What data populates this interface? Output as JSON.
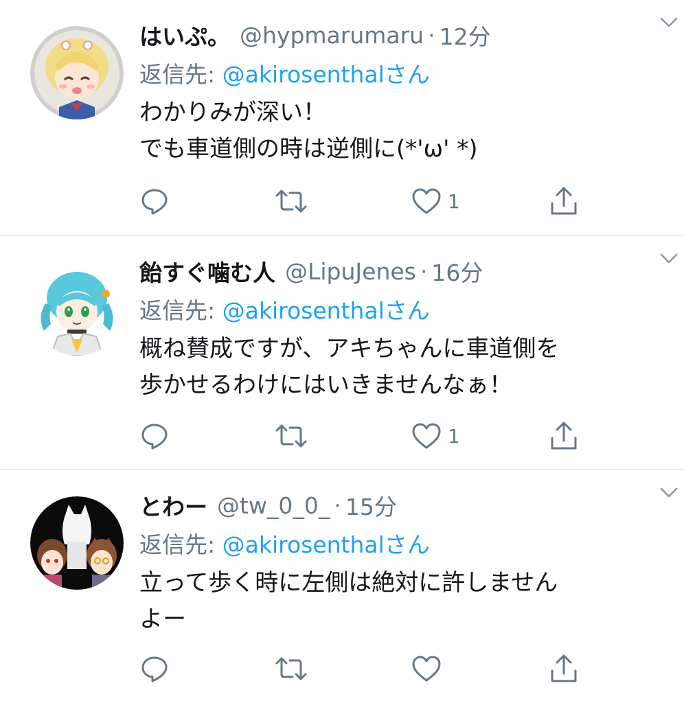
{
  "tweets": [
    {
      "name": "はいぷ。",
      "handle": "@hypmarumaru",
      "separator": "·",
      "time": "12分",
      "reply_prefix": "返信先: ",
      "reply_mention": "@akirosenthalさん",
      "text": "わかりみが深い！\nでも車道側の時は逆側に(*'ω' *)",
      "like_count": "1",
      "avatar_icon": "avatar-blonde-girl"
    },
    {
      "name": "飴すぐ噛む人",
      "handle": "@LipuJenes",
      "separator": "·",
      "time": "16分",
      "reply_prefix": "返信先: ",
      "reply_mention": "@akirosenthalさん",
      "text": "概ね賛成ですが、アキちゃんに車道側を\n歩かせるわけにはいきませんなぁ！",
      "like_count": "1",
      "avatar_icon": "avatar-cyan-hair-girl"
    },
    {
      "name": "とわー",
      "handle": "@tw_0_0_",
      "separator": "·",
      "time": "15分",
      "reply_prefix": "返信先: ",
      "reply_mention": "@akirosenthalさん",
      "text": "立って歩く時に左側は絶対に許しません\nよー",
      "like_count": "",
      "avatar_icon": "avatar-group-dark"
    }
  ],
  "icons": {
    "caret": "chevron-down-icon",
    "reply": "reply-icon",
    "retweet": "retweet-icon",
    "like": "heart-icon",
    "share": "share-icon"
  },
  "colors": {
    "mention": "#1da1f2",
    "secondary_text": "#657786",
    "primary_text": "#14171a",
    "divider": "#e6ecf0"
  }
}
